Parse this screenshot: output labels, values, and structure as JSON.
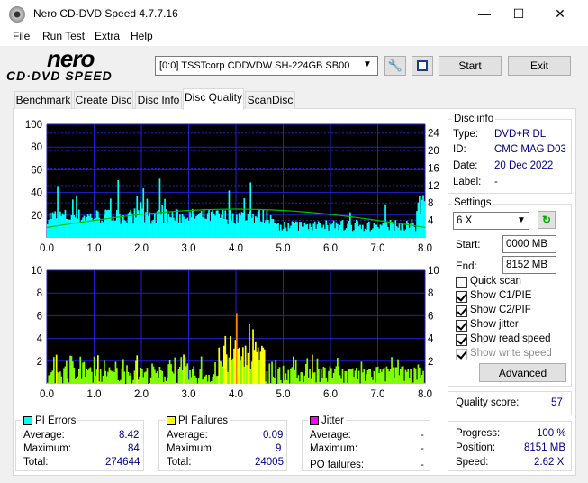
{
  "window": {
    "title": "Nero CD-DVD Speed 4.7.7.16",
    "minimize": "—",
    "maximize": "☐",
    "close": "✕"
  },
  "menu": [
    "File",
    "Run Test",
    "Extra",
    "Help"
  ],
  "logo": {
    "main": "nero",
    "sub": "CD·DVD SPEED"
  },
  "toolbar": {
    "drive": "[0:0]   TSSTcorp CDDVDW SH-224GB SB00",
    "start": "Start",
    "exit": "Exit"
  },
  "tabs": [
    "Benchmark",
    "Create Disc",
    "Disc Info",
    "Disc Quality",
    "ScanDisc"
  ],
  "active_tab": "Disc Quality",
  "disc_info": {
    "title": "Disc info",
    "type_label": "Type:",
    "type": "DVD+R DL",
    "id_label": "ID:",
    "id": "CMC MAG D03",
    "date_label": "Date:",
    "date": "20 Dec 2022",
    "label_label": "Label:",
    "label": "-"
  },
  "settings": {
    "title": "Settings",
    "speed": "6 X",
    "start_label": "Start:",
    "start": "0000 MB",
    "end_label": "End:",
    "end": "8152 MB",
    "quick_scan": "Quick scan",
    "show_c1": "Show C1/PIE",
    "show_c2": "Show C2/PIF",
    "show_jitter": "Show jitter",
    "show_read": "Show read speed",
    "show_write": "Show write speed",
    "advanced": "Advanced"
  },
  "quality": {
    "label": "Quality score:",
    "value": "57"
  },
  "progress": {
    "progress_label": "Progress:",
    "progress": "100 %",
    "position_label": "Position:",
    "position": "8151 MB",
    "speed_label": "Speed:",
    "speed": "2.62 X"
  },
  "pi_errors": {
    "title": "PI Errors",
    "avg_label": "Average:",
    "avg": "8.42",
    "max_label": "Maximum:",
    "max": "84",
    "total_label": "Total:",
    "total": "274644",
    "color": "#00ffff"
  },
  "pi_failures": {
    "title": "PI Failures",
    "avg_label": "Average:",
    "avg": "0.09",
    "max_label": "Maximum:",
    "max": "9",
    "total_label": "Total:",
    "total": "24005",
    "color": "#ffff00"
  },
  "jitter": {
    "title": "Jitter",
    "avg_label": "Average:",
    "avg": "-",
    "max_label": "Maximum:",
    "max": "-",
    "po_label": "PO failures:",
    "po": "-",
    "color": "#ff00ff"
  },
  "chart_data": [
    {
      "type": "bar",
      "name": "PI Errors",
      "x_ticks": [
        "0.0",
        "1.0",
        "2.0",
        "3.0",
        "4.0",
        "5.0",
        "6.0",
        "7.0",
        "8.0"
      ],
      "y_ticks_left": [
        "20",
        "40",
        "60",
        "80",
        "100"
      ],
      "y_ticks_right": [
        "4",
        "8",
        "12",
        "16",
        "20",
        "24"
      ],
      "xlim": [
        0,
        8
      ],
      "ylim": [
        0,
        100
      ],
      "y2lim": [
        0,
        26
      ],
      "color": "#00ffff",
      "line_color": "#00c000"
    },
    {
      "type": "bar",
      "name": "PI Failures",
      "x_ticks": [
        "0.0",
        "1.0",
        "2.0",
        "3.0",
        "4.0",
        "5.0",
        "6.0",
        "7.0",
        "8.0"
      ],
      "y_ticks_left": [
        "2",
        "4",
        "6",
        "8",
        "10"
      ],
      "y_ticks_right": [
        "2",
        "4",
        "6",
        "8",
        "10"
      ],
      "xlim": [
        0,
        8
      ],
      "ylim": [
        0,
        10
      ],
      "color": "#ffff00",
      "base_color": "#80ff00",
      "peak_color": "#ff8000"
    }
  ]
}
